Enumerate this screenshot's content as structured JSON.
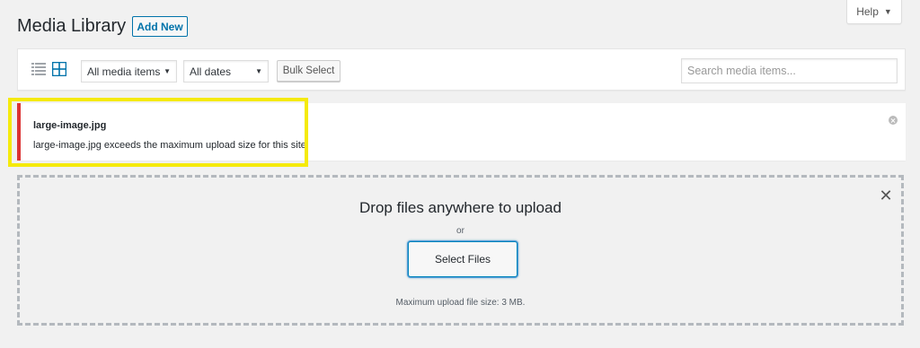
{
  "help": {
    "label": "Help"
  },
  "header": {
    "title": "Media Library",
    "add_new_label": "Add New"
  },
  "toolbar": {
    "media_filter": "All media items",
    "date_filter": "All dates",
    "bulk_select_label": "Bulk Select",
    "search_placeholder": "Search media items...",
    "list_view_icon": "list-view-icon",
    "grid_view_icon": "grid-view-icon"
  },
  "notice": {
    "filename": "large-image.jpg",
    "message": "large-image.jpg exceeds the maximum upload size for this site.",
    "border_color": "#dc3232",
    "highlight_color": "#f5ea0a"
  },
  "uploader": {
    "drop_text": "Drop files anywhere to upload",
    "or_text": "or",
    "select_files_label": "Select Files",
    "max_size_text": "Maximum upload file size: 3 MB."
  },
  "colors": {
    "accent": "#0073aa",
    "error": "#dc3232",
    "background": "#f1f1f1"
  }
}
